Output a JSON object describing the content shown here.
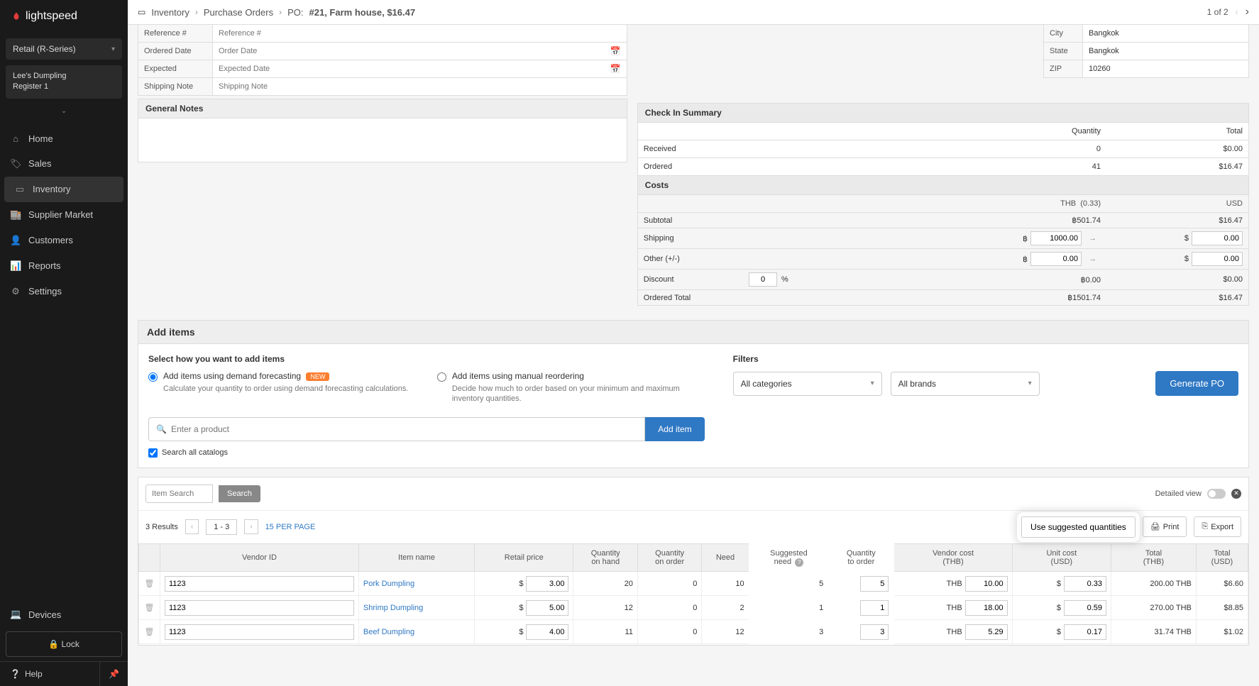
{
  "app": {
    "brand": "lightspeed",
    "retail_series": "Retail (R-Series)",
    "location_name": "Lee's Dumpling",
    "register_name": "Register 1"
  },
  "nav": {
    "home": "Home",
    "sales": "Sales",
    "inventory": "Inventory",
    "supplier_market": "Supplier Market",
    "customers": "Customers",
    "reports": "Reports",
    "settings": "Settings",
    "devices": "Devices",
    "lock": "Lock",
    "help": "Help"
  },
  "breadcrumb": {
    "c1": "Inventory",
    "c2": "Purchase Orders",
    "c3_prefix": "PO:",
    "c3_title": "#21, Farm house, $16.47"
  },
  "pager_top": {
    "label": "1 of 2"
  },
  "po_fields": {
    "reference_label": "Reference #",
    "reference_ph": "Reference #",
    "ordered_label": "Ordered Date",
    "ordered_ph": "Order Date",
    "expected_label": "Expected",
    "expected_ph": "Expected Date",
    "shipping_note_label": "Shipping Note",
    "shipping_note_ph": "Shipping Note",
    "general_notes_label": "General Notes"
  },
  "address": {
    "city_label": "City",
    "city": "Bangkok",
    "state_label": "State",
    "state": "Bangkok",
    "zip_label": "ZIP",
    "zip": "10260"
  },
  "checkin": {
    "header": "Check In Summary",
    "qty_label": "Quantity",
    "total_label": "Total",
    "received_label": "Received",
    "received_qty": "0",
    "received_total": "$0.00",
    "ordered_label": "Ordered",
    "ordered_qty": "41",
    "ordered_total": "$16.47"
  },
  "costs": {
    "header": "Costs",
    "thb_label": "THB",
    "thb_rate": "(0.33)",
    "usd_label": "USD",
    "subtotal_label": "Subtotal",
    "subtotal_thb": "฿501.74",
    "subtotal_usd": "$16.47",
    "shipping_label": "Shipping",
    "shipping_thb": "1000.00",
    "shipping_usd": "0.00",
    "other_label": "Other (+/-)",
    "other_thb": "0.00",
    "other_usd": "0.00",
    "discount_label": "Discount",
    "discount_pct": "0",
    "discount_sym": "%",
    "discount_thb": "฿0.00",
    "discount_usd": "$0.00",
    "ordered_total_label": "Ordered Total",
    "ordered_total_thb": "฿1501.74",
    "ordered_total_usd": "$16.47",
    "cur_thb_sym": "฿",
    "cur_usd_sym": "$"
  },
  "add_items": {
    "header": "Add items",
    "select_how": "Select how you want to add items",
    "opt1_label": "Add items using demand forecasting",
    "new_badge": "NEW",
    "opt1_desc": "Calculate your quantity to order using demand forecasting calculations.",
    "opt2_label": "Add items using manual reordering",
    "opt2_desc": "Decide how much to order based on your minimum and maximum inventory quantities.",
    "search_ph": "Enter a product",
    "add_item_btn": "Add item",
    "search_all": "Search all catalogs",
    "filters_label": "Filters",
    "all_categories": "All categories",
    "all_brands": "All brands",
    "generate_po": "Generate PO"
  },
  "item_table": {
    "search_ph": "Item Search",
    "search_btn": "Search",
    "detailed_view": "Detailed view",
    "results": "3 Results",
    "page_range": "1 - 3",
    "per_page": "15 PER PAGE",
    "use_suggested": "Use suggested quantities",
    "print": "Print",
    "export": "Export",
    "cols": {
      "vendor_id": "Vendor ID",
      "item_name": "Item name",
      "retail_price": "Retail price",
      "qty_on_hand_l1": "Quantity",
      "qty_on_hand_l2": "on hand",
      "qty_on_order_l1": "Quantity",
      "qty_on_order_l2": "on order",
      "need": "Need",
      "sugg_l1": "Suggested",
      "sugg_l2": "need",
      "qty_to_order_l1": "Quantity",
      "qty_to_order_l2": "to order",
      "vendor_cost_l1": "Vendor cost",
      "vendor_cost_l2": "(THB)",
      "unit_cost_l1": "Unit cost",
      "unit_cost_l2": "(USD)",
      "total_thb_l1": "Total",
      "total_thb_l2": "(THB)",
      "total_usd_l1": "Total",
      "total_usd_l2": "(USD)"
    },
    "rows": [
      {
        "vendor_id": "1123",
        "name": "Pork Dumpling",
        "price": "3.00",
        "on_hand": "20",
        "on_order": "0",
        "need": "10",
        "sugg": "5",
        "qty": "5",
        "vc_cur": "THB",
        "vc": "10.00",
        "uc_cur": "$",
        "uc": "0.33",
        "tot_thb": "200.00 THB",
        "tot_usd": "$6.60"
      },
      {
        "vendor_id": "1123",
        "name": "Shrimp Dumpling",
        "price": "5.00",
        "on_hand": "12",
        "on_order": "0",
        "need": "2",
        "sugg": "1",
        "qty": "1",
        "vc_cur": "THB",
        "vc": "18.00",
        "uc_cur": "$",
        "uc": "0.59",
        "tot_thb": "270.00 THB",
        "tot_usd": "$8.85"
      },
      {
        "vendor_id": "1123",
        "name": "Beef Dumpling",
        "price": "4.00",
        "on_hand": "11",
        "on_order": "0",
        "need": "12",
        "sugg": "3",
        "qty": "3",
        "vc_cur": "THB",
        "vc": "5.29",
        "uc_cur": "$",
        "uc": "0.17",
        "tot_thb": "31.74 THB",
        "tot_usd": "$1.02"
      }
    ],
    "price_cur": "$"
  }
}
